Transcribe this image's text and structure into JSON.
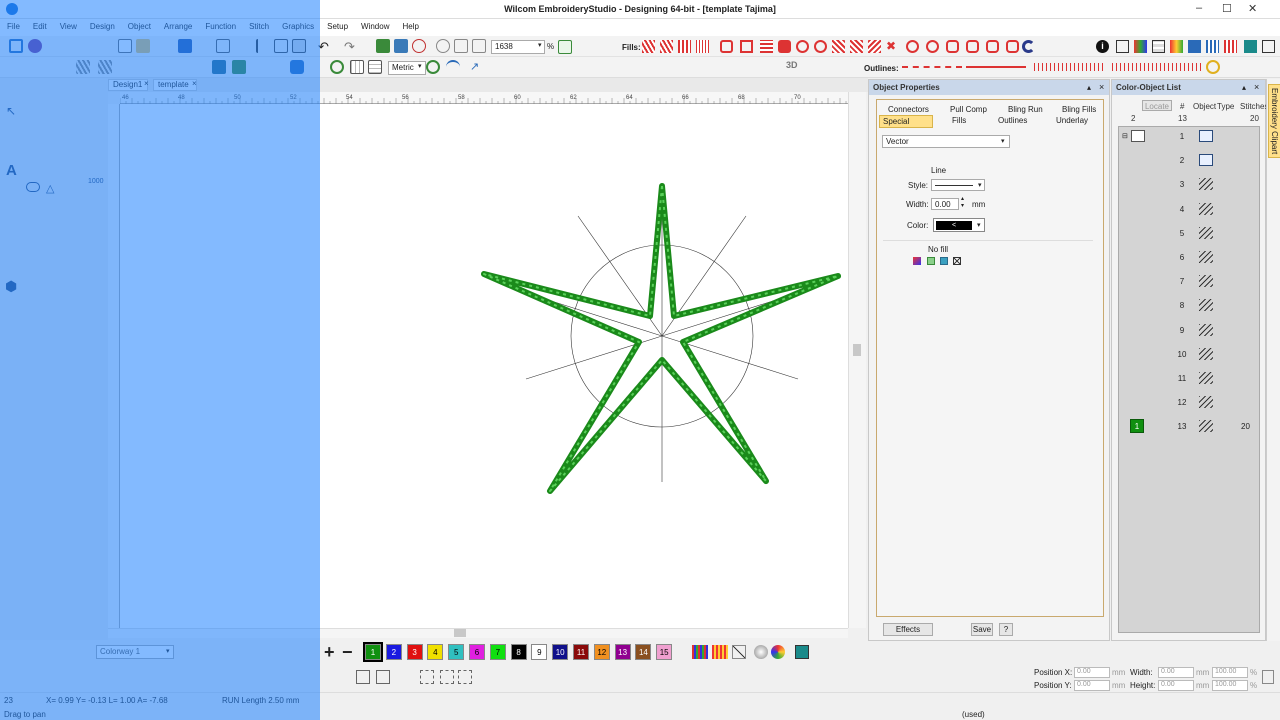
{
  "window": {
    "title": "Wilcom EmbroideryStudio - Designing 64-bit - [template          Tajima]",
    "controls": [
      "minimize-icon",
      "maximize-icon",
      "close-icon"
    ]
  },
  "menu": [
    "File",
    "Edit",
    "View",
    "Design",
    "Object",
    "Arrange",
    "Function",
    "Stitch",
    "Graphics",
    "Setup",
    "Window",
    "Help"
  ],
  "toolbar": {
    "zoom_value": "1638",
    "zoom_unit": "%",
    "fills_label": "Fills:",
    "outlines_label": "Outlines:",
    "units_value": "Metric",
    "view_3d": "3D"
  },
  "document_tabs": [
    "Design1",
    "template"
  ],
  "ruler": {
    "top_ticks": [
      "46",
      "48",
      "50",
      "52",
      "54",
      "56",
      "58",
      "60",
      "62",
      "64",
      "66",
      "68",
      "70"
    ]
  },
  "colorbar": {
    "colorway": "Colorway 1",
    "swatches": [
      {
        "label": "1",
        "color": "#109010"
      },
      {
        "label": "2",
        "color": "#1a1ae0"
      },
      {
        "label": "3",
        "color": "#e01010"
      },
      {
        "label": "4",
        "color": "#f0e000"
      },
      {
        "label": "5",
        "color": "#30c0c0"
      },
      {
        "label": "6",
        "color": "#e020e0"
      },
      {
        "label": "7",
        "color": "#10e010"
      },
      {
        "label": "8",
        "color": "#000000"
      },
      {
        "label": "9",
        "color": "#ffffff"
      },
      {
        "label": "10",
        "color": "#10108a"
      },
      {
        "label": "11",
        "color": "#8a0a0a"
      },
      {
        "label": "12",
        "color": "#f09020"
      },
      {
        "label": "13",
        "color": "#900090"
      },
      {
        "label": "14",
        "color": "#8a5020"
      },
      {
        "label": "15",
        "color": "#f0a0d0"
      }
    ]
  },
  "object_properties": {
    "title": "Object Properties",
    "tabs_row1": [
      "Connectors",
      "Pull Comp",
      "Bling Run",
      "Bling Fills"
    ],
    "tabs_row2": [
      "Special",
      "Fills",
      "Outlines",
      "Underlay"
    ],
    "active_tab": "Special",
    "type_select": "Vector",
    "line_heading": "Line",
    "style_label": "Style:",
    "width_label": "Width:",
    "width_value": "0.00",
    "width_unit": "mm",
    "color_label": "Color:",
    "color_value": "<",
    "fill_heading": "No fill",
    "effects_button": "Effects",
    "save_button": "Save",
    "help_button": "?"
  },
  "color_object_list": {
    "title": "Color-Object List",
    "locate_button": "Locate",
    "columns": [
      "#",
      "Object",
      "Type",
      "Stitches"
    ],
    "summary": {
      "left": "2",
      "count": "13",
      "stitches": "20"
    },
    "rows": [
      {
        "num": "1",
        "stitches": ""
      },
      {
        "num": "2",
        "stitches": ""
      },
      {
        "num": "3",
        "stitches": ""
      },
      {
        "num": "4",
        "stitches": ""
      },
      {
        "num": "5",
        "stitches": ""
      },
      {
        "num": "6",
        "stitches": ""
      },
      {
        "num": "7",
        "stitches": ""
      },
      {
        "num": "8",
        "stitches": ""
      },
      {
        "num": "9",
        "stitches": ""
      },
      {
        "num": "10",
        "stitches": ""
      },
      {
        "num": "11",
        "stitches": ""
      },
      {
        "num": "12",
        "stitches": ""
      },
      {
        "num": "13",
        "stitches": "20"
      }
    ],
    "color_block_label": "1"
  },
  "side_tab": "Embroidery Clipart",
  "position": {
    "pos_x_label": "Position X:",
    "pos_y_label": "Position Y:",
    "pos_x": "0.00",
    "pos_y": "0.00",
    "width_label": "Width:",
    "height_label": "Height:",
    "width": "0.00",
    "height": "0.00",
    "unit": "mm",
    "pct_w": "100.00",
    "pct_h": "100.00",
    "pct": "%"
  },
  "status": {
    "count": "23",
    "coords": "X=  0.99 Y=  -0.13 L=  1.00 A= -7.68",
    "run_length": "RUN Length   2.50 mm",
    "hint": "Drag to pan",
    "used": "(used)"
  },
  "overlay_color": "#1e82ff",
  "star_color": "#1a8a1a"
}
